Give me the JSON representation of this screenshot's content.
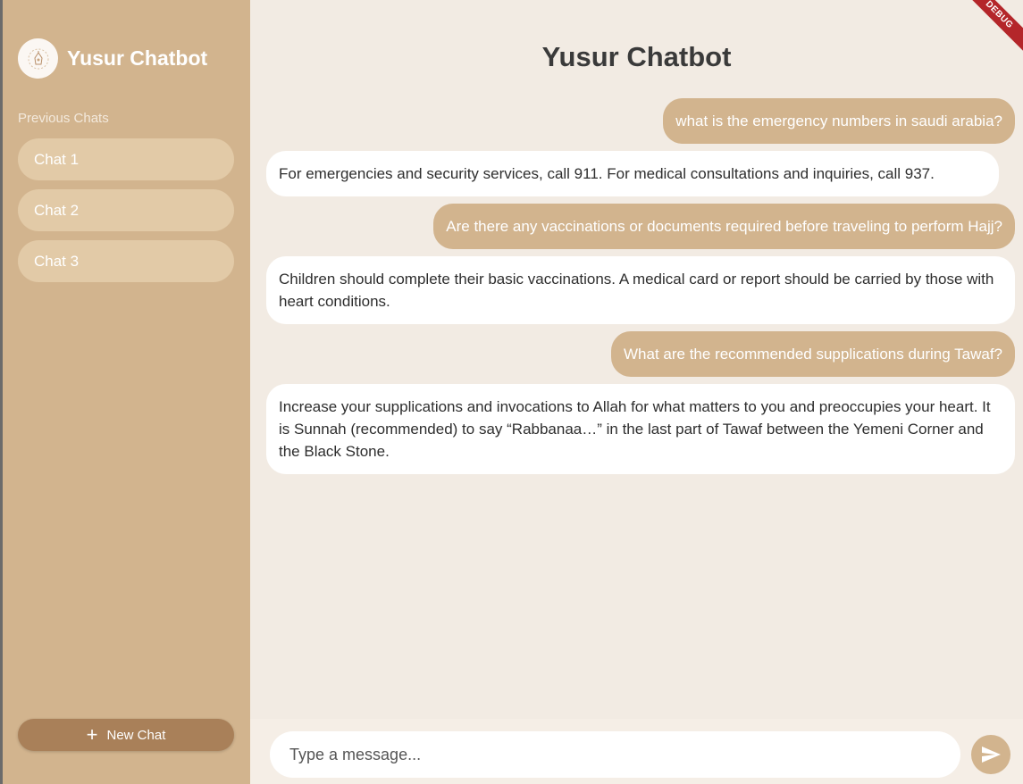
{
  "sidebar": {
    "brand_title": "Yusur Chatbot",
    "previous_label": "Previous Chats",
    "chats": [
      "Chat 1",
      "Chat 2",
      "Chat 3"
    ],
    "new_chat_label": "New Chat",
    "avatar_icon": "lantern-logo-icon"
  },
  "main": {
    "title": "Yusur Chatbot",
    "messages": [
      {
        "role": "user",
        "text": "what is the emergency numbers in saudi arabia?"
      },
      {
        "role": "bot",
        "text": "For emergencies and security services, call 911. For medical consultations and inquiries, call 937."
      },
      {
        "role": "user",
        "text": "Are there any vaccinations or documents required before traveling to perform Hajj?"
      },
      {
        "role": "bot",
        "text": "Children should complete their basic vaccinations.  A medical card or report should be carried by those with heart conditions."
      },
      {
        "role": "user",
        "text": "What are the recommended supplications during Tawaf?"
      },
      {
        "role": "bot",
        "text": "Increase your supplications and invocations to Allah for what matters to you and preoccupies your heart.  It is Sunnah (recommended) to say “Rabbanaa…” in the last part of Tawaf between the Yemeni Corner and the Black Stone."
      }
    ],
    "input_placeholder": "Type a message...",
    "send_icon": "send-icon",
    "debug_label": "DEBUG"
  },
  "colors": {
    "sidebar": "#d2b48e",
    "chat_item": "#e2caa7",
    "new_chat": "#a98059",
    "main_bg": "#f2ebe3",
    "user_bubble": "#d2b48e",
    "bot_bubble": "#ffffff"
  }
}
